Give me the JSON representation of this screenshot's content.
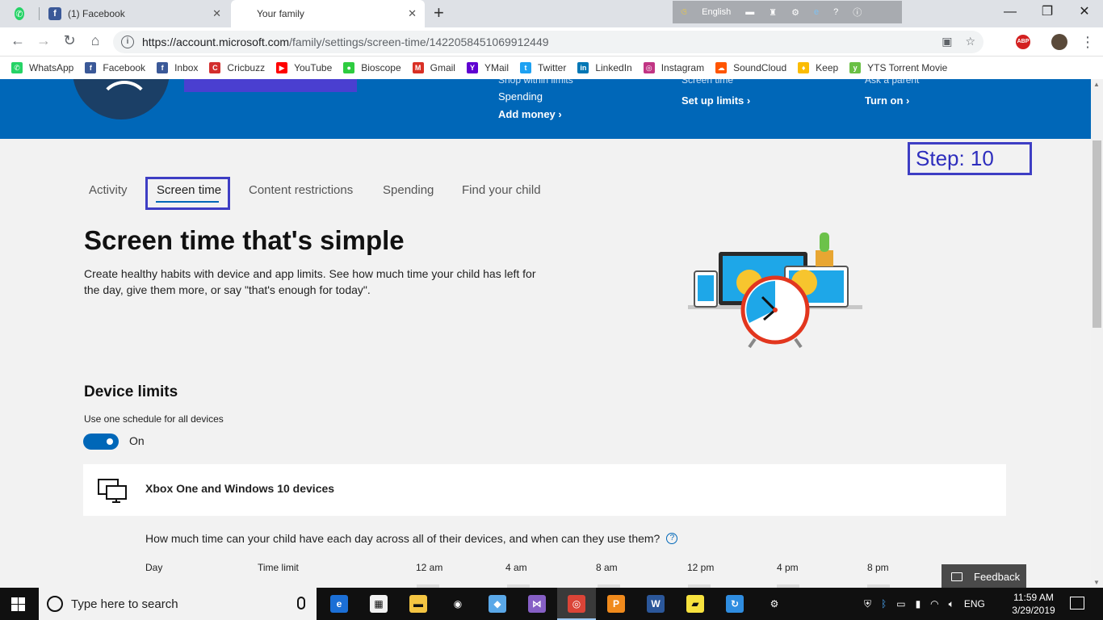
{
  "browser": {
    "tabs": [
      {
        "title": "",
        "icon": "whatsapp-icon",
        "color": "#25d366"
      },
      {
        "title": "(1) Facebook",
        "icon": "facebook-icon",
        "color": "#3b5998"
      },
      {
        "title": "Your family",
        "icon": "microsoft-icon",
        "color": "#f25022",
        "active": true
      }
    ],
    "language_label": "English",
    "url_host": "https://account.microsoft.com",
    "url_path": "/family/settings/screen-time/1422058451069912449",
    "abp_label": "ABP"
  },
  "bookmarks": [
    {
      "label": "WhatsApp",
      "icon": "whatsapp-icon",
      "color": "#25d366"
    },
    {
      "label": "Facebook",
      "icon": "facebook-icon",
      "color": "#3b5998"
    },
    {
      "label": "Inbox",
      "icon": "facebook-icon",
      "color": "#3b5998"
    },
    {
      "label": "Cricbuzz",
      "icon": "cricbuzz-icon",
      "color": "#d32f2f"
    },
    {
      "label": "YouTube",
      "icon": "youtube-icon",
      "color": "#ff0000"
    },
    {
      "label": "Bioscope",
      "icon": "bioscope-icon",
      "color": "#2ecc40"
    },
    {
      "label": "Gmail",
      "icon": "gmail-icon",
      "color": "#d93025"
    },
    {
      "label": "YMail",
      "icon": "yahoo-icon",
      "color": "#5f01d1"
    },
    {
      "label": "Twitter",
      "icon": "twitter-icon",
      "color": "#1da1f2"
    },
    {
      "label": "LinkedIn",
      "icon": "linkedin-icon",
      "color": "#0077b5"
    },
    {
      "label": "Instagram",
      "icon": "instagram-icon",
      "color": "#c13584"
    },
    {
      "label": "SoundCloud",
      "icon": "soundcloud-icon",
      "color": "#ff5500"
    },
    {
      "label": "Keep",
      "icon": "keep-icon",
      "color": "#fbbc04"
    },
    {
      "label": "YTS Torrent Movie",
      "icon": "yts-icon",
      "color": "#6ac045"
    }
  ],
  "hero": {
    "col1_cut": "Shop within limits",
    "col1_label": "Spending",
    "col1_link": "Add money",
    "col2_cut": "Screen time",
    "col2_link": "Set up limits",
    "col3_cut": "Ask a parent",
    "col3_link": "Turn on"
  },
  "step_label": "Step: 10",
  "page_tabs": [
    "Activity",
    "Screen time",
    "Content restrictions",
    "Spending",
    "Find your child"
  ],
  "main": {
    "title": "Screen time that's simple",
    "intro": "Create healthy habits with device and app limits. See how much time your child has left for the day, give them more, or say \"that's enough for today\".",
    "device_limits_heading": "Device limits",
    "schedule_label": "Use one schedule for all devices",
    "toggle_state": "On",
    "toggle_on": true,
    "device_card_title": "Xbox One and Windows 10 devices",
    "question": "How much time can your child have each day across all of their devices, and when can they use them?",
    "columns": [
      "Day",
      "Time limit",
      "12 am",
      "4 am",
      "8 am",
      "12 pm",
      "4 pm",
      "8 pm"
    ]
  },
  "feedback_label": "Feedback",
  "taskbar": {
    "search_placeholder": "Type here to search",
    "apps": [
      "edge-icon",
      "store-icon",
      "file-explorer-icon",
      "groove-icon",
      "3d-viewer-icon",
      "visual-studio-icon",
      "chrome-icon",
      "pdf-icon",
      "word-icon",
      "sticky-notes-icon",
      "sync-icon",
      "settings-icon"
    ],
    "language": "ENG",
    "time": "11:59 AM",
    "date": "3/29/2019"
  },
  "colors": {
    "accent": "#0067b8",
    "highlight": "#3e3ec4"
  }
}
